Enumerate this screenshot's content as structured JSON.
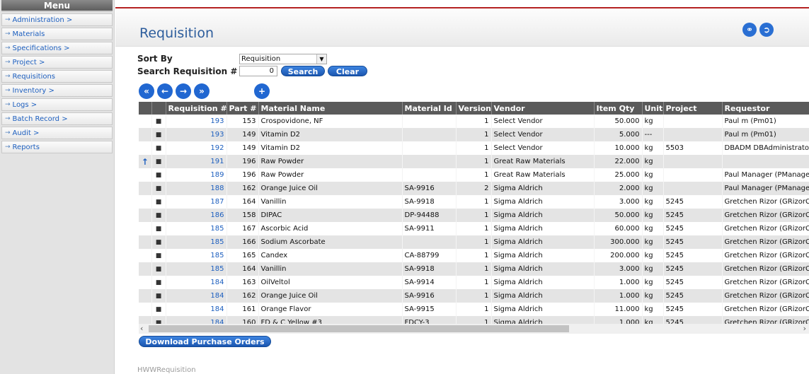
{
  "sidebar": {
    "header": "Menu",
    "items": [
      {
        "label": "Administration >"
      },
      {
        "label": "Materials"
      },
      {
        "label": "Specifications >"
      },
      {
        "label": "Project >"
      },
      {
        "label": "Requisitions"
      },
      {
        "label": "Inventory >"
      },
      {
        "label": "Logs >"
      },
      {
        "label": "Batch Record >"
      },
      {
        "label": "Audit >"
      },
      {
        "label": "Reports"
      }
    ]
  },
  "page": {
    "title": "Requisition",
    "footer": "HWWRequisition"
  },
  "controls": {
    "sort_label": "Sort By",
    "sort_value": "Requisition",
    "search_label": "Search Requisition #",
    "search_value": "0",
    "search_button": "Search",
    "clear_button": "Clear",
    "download_button": "Download Purchase Orders"
  },
  "table": {
    "columns": [
      "",
      "",
      "Requisition #",
      "Part #",
      "Material Name",
      "Material Id",
      "Version",
      "Vendor",
      "Item Qty",
      "Unit",
      "Project",
      "Requestor"
    ],
    "rows": [
      {
        "mark": "",
        "req": "193",
        "part": "153",
        "name": "Crospovidone, NF",
        "mid": "",
        "ver": "1",
        "vendor": "Select Vendor",
        "qty": "50.000",
        "unit": "kg",
        "project": "",
        "requestor": "Paul m (Pm01)"
      },
      {
        "mark": "",
        "req": "193",
        "part": "149",
        "name": "Vitamin D2",
        "mid": "",
        "ver": "1",
        "vendor": "Select Vendor",
        "qty": "5.000",
        "unit": "---",
        "project": "",
        "requestor": "Paul m (Pm01)"
      },
      {
        "mark": "",
        "req": "192",
        "part": "149",
        "name": "Vitamin D2",
        "mid": "",
        "ver": "1",
        "vendor": "Select Vendor",
        "qty": "10.000",
        "unit": "kg",
        "project": "5503",
        "requestor": "DBADM DBAdministrator"
      },
      {
        "mark": "↑",
        "req": "191",
        "part": "196",
        "name": "Raw Powder",
        "mid": "",
        "ver": "1",
        "vendor": "Great Raw Materials",
        "qty": "22.000",
        "unit": "kg",
        "project": "",
        "requestor": ""
      },
      {
        "mark": "",
        "req": "189",
        "part": "196",
        "name": "Raw Powder",
        "mid": "",
        "ver": "1",
        "vendor": "Great Raw Materials",
        "qty": "25.000",
        "unit": "kg",
        "project": "",
        "requestor": "Paul Manager (PManager)"
      },
      {
        "mark": "",
        "req": "188",
        "part": "162",
        "name": "Orange Juice Oil",
        "mid": "SA-9916",
        "ver": "2",
        "vendor": "Sigma Aldrich",
        "qty": "2.000",
        "unit": "kg",
        "project": "",
        "requestor": "Paul Manager (PManager)"
      },
      {
        "mark": "",
        "req": "187",
        "part": "164",
        "name": "Vanillin",
        "mid": "SA-9918",
        "ver": "1",
        "vendor": "Sigma Aldrich",
        "qty": "3.000",
        "unit": "kg",
        "project": "5245",
        "requestor": "Gretchen Rizor (GRizorC)"
      },
      {
        "mark": "",
        "req": "186",
        "part": "158",
        "name": "DIPAC",
        "mid": "DP-94488",
        "ver": "1",
        "vendor": "Sigma Aldrich",
        "qty": "50.000",
        "unit": "kg",
        "project": "5245",
        "requestor": "Gretchen Rizor (GRizorC)"
      },
      {
        "mark": "",
        "req": "185",
        "part": "167",
        "name": "Ascorbic Acid",
        "mid": "SA-9911",
        "ver": "1",
        "vendor": "Sigma Aldrich",
        "qty": "60.000",
        "unit": "kg",
        "project": "5245",
        "requestor": "Gretchen Rizor (GRizorC)"
      },
      {
        "mark": "",
        "req": "185",
        "part": "166",
        "name": "Sodium Ascorbate",
        "mid": "",
        "ver": "1",
        "vendor": "Sigma Aldrich",
        "qty": "300.000",
        "unit": "kg",
        "project": "5245",
        "requestor": "Gretchen Rizor (GRizorC)"
      },
      {
        "mark": "",
        "req": "185",
        "part": "165",
        "name": "Candex",
        "mid": "CA-88799",
        "ver": "1",
        "vendor": "Sigma Aldrich",
        "qty": "200.000",
        "unit": "kg",
        "project": "5245",
        "requestor": "Gretchen Rizor (GRizorC)"
      },
      {
        "mark": "",
        "req": "185",
        "part": "164",
        "name": "Vanillin",
        "mid": "SA-9918",
        "ver": "1",
        "vendor": "Sigma Aldrich",
        "qty": "3.000",
        "unit": "kg",
        "project": "5245",
        "requestor": "Gretchen Rizor (GRizorC)"
      },
      {
        "mark": "",
        "req": "184",
        "part": "163",
        "name": "OilVeltol",
        "mid": "SA-9914",
        "ver": "1",
        "vendor": "Sigma Aldrich",
        "qty": "1.000",
        "unit": "kg",
        "project": "5245",
        "requestor": "Gretchen Rizor (GRizorC)"
      },
      {
        "mark": "",
        "req": "184",
        "part": "162",
        "name": "Orange Juice Oil",
        "mid": "SA-9916",
        "ver": "1",
        "vendor": "Sigma Aldrich",
        "qty": "1.000",
        "unit": "kg",
        "project": "5245",
        "requestor": "Gretchen Rizor (GRizorC)"
      },
      {
        "mark": "",
        "req": "184",
        "part": "161",
        "name": "Orange Flavor",
        "mid": "SA-9915",
        "ver": "1",
        "vendor": "Sigma Aldrich",
        "qty": "11.000",
        "unit": "kg",
        "project": "5245",
        "requestor": "Gretchen Rizor (GRizorC)"
      },
      {
        "mark": "",
        "req": "184",
        "part": "160",
        "name": "FD & C Yellow #3",
        "mid": "FDCY-3",
        "ver": "1",
        "vendor": "Sigma Aldrich",
        "qty": "1.000",
        "unit": "kg",
        "project": "5245",
        "requestor": "Gretchen Rizor (GRizorC)"
      }
    ]
  },
  "colors": {
    "accent": "#2167d1",
    "title": "#2d5d9c",
    "header_bar": "#5a5a5a",
    "top_line": "#b52222"
  }
}
